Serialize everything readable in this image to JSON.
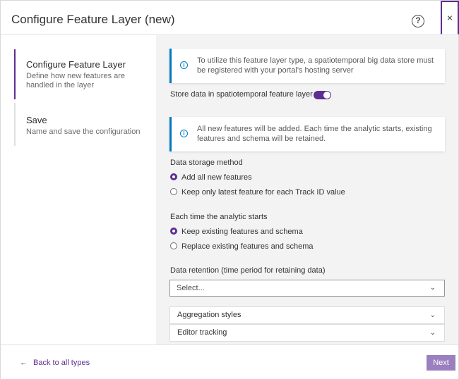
{
  "header": {
    "title": "Configure Feature Layer (new)",
    "help_icon": "?",
    "close_icon": "×"
  },
  "steps": [
    {
      "title": "Configure Feature Layer",
      "description": "Define how new features are handled in the layer",
      "active": true
    },
    {
      "title": "Save",
      "description": "Name and save the configuration",
      "active": false
    }
  ],
  "content": {
    "notice_1": "To utilize this feature layer type, a spatiotemporal big data store must be registered with your portal's hosting server",
    "toggle_label": "Store data in spatiotemporal feature layer",
    "toggle_on": true,
    "notice_2": "All new features will be added. Each time the analytic starts, existing features and schema will be retained.",
    "storage_method": {
      "label": "Data storage method",
      "options": [
        "Add all new features",
        "Keep only latest feature for each Track ID value"
      ],
      "selected": 0
    },
    "analytic_start": {
      "label": "Each time the analytic starts",
      "options": [
        "Keep existing features and schema",
        "Replace existing features and schema"
      ],
      "selected": 0
    },
    "retention": {
      "label": "Data retention (time period for retaining data)",
      "placeholder": "Select..."
    },
    "accordions": [
      "Aggregation styles",
      "Editor tracking"
    ]
  },
  "footer": {
    "back_arrow": "←",
    "back_label": "Back to all types",
    "next_label": "Next"
  },
  "colors": {
    "accent": "#5e2d91",
    "info": "#0079c1",
    "next_disabled": "#9b80bf"
  }
}
